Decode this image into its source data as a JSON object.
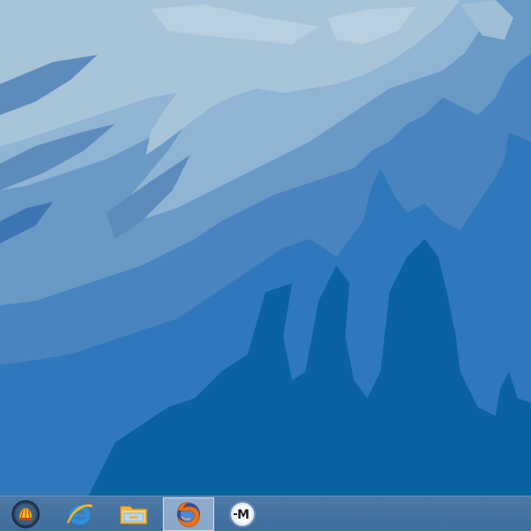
{
  "desktop": {
    "wallpaper": "blue-mountain-wallpaper",
    "colors": {
      "sky": "#a7c4d8",
      "mid_light": "#7aa4c7",
      "mid": "#5c8fbe",
      "mid_dark": "#3d7cbc",
      "dark": "#0a63a0"
    }
  },
  "taskbar": {
    "background": "#4c79a6",
    "items": [
      {
        "name": "start-button",
        "icon": "shell-orb-icon",
        "active": false
      },
      {
        "name": "internet-explorer",
        "icon": "internet-explorer-icon",
        "active": false
      },
      {
        "name": "file-explorer",
        "icon": "folder-icon",
        "active": false
      },
      {
        "name": "firefox",
        "icon": "firefox-icon",
        "active": true
      },
      {
        "name": "m-app",
        "icon": "m-app-icon",
        "active": false,
        "label": "M"
      }
    ]
  }
}
